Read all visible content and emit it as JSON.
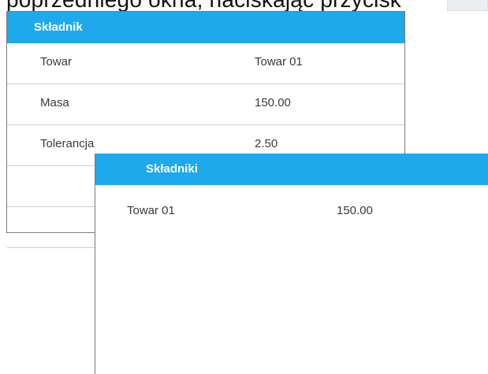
{
  "caption": {
    "text": "poprzedniego okna, naciskając przycisk"
  },
  "component_window": {
    "title": "Składnik",
    "rows": [
      {
        "label": "Towar",
        "value": "Towar 01"
      },
      {
        "label": "Masa",
        "value": "150.00"
      },
      {
        "label": "Tolerancja",
        "value": "2.50"
      },
      {
        "label": "",
        "value": ""
      },
      {
        "label": "",
        "value": ""
      }
    ]
  },
  "components_window": {
    "title": "Składniki",
    "items": [
      {
        "name": "Towar 01",
        "amount": "150.00"
      }
    ]
  },
  "colors": {
    "header_bg": "#1da9ec",
    "header_text": "#ffffff",
    "row_divider": "#cfcfcf",
    "window_border": "#7a7a7a"
  }
}
